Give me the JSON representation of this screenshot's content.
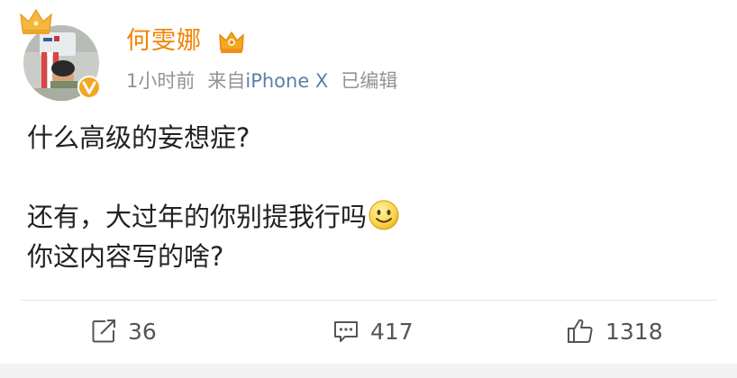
{
  "post": {
    "author": {
      "name": "何雯娜",
      "avatar_icon": "avatar-photo",
      "crown_icon": "crown-icon",
      "verified_icon": "verified-v-icon",
      "member_icon": "vip-crown-icon"
    },
    "meta": {
      "time": "1小时前",
      "source_prefix": "来自",
      "source_device": "iPhone X",
      "edited": "已编辑"
    },
    "text": {
      "line1": "什么高级的妄想症?",
      "line2": "还有，大过年的你别提我行吗",
      "line3": "你这内容写的啥?"
    },
    "emoji": "smile-emoji"
  },
  "actions": {
    "repost": {
      "icon": "repost-icon",
      "count": "36"
    },
    "comment": {
      "icon": "comment-icon",
      "count": "417"
    },
    "like": {
      "icon": "thumbs-up-icon",
      "count": "1318"
    }
  },
  "colors": {
    "username": "#f08300",
    "meta": "#939393",
    "source_link": "#5b7fa8",
    "text": "#222222",
    "action": "#555555"
  }
}
